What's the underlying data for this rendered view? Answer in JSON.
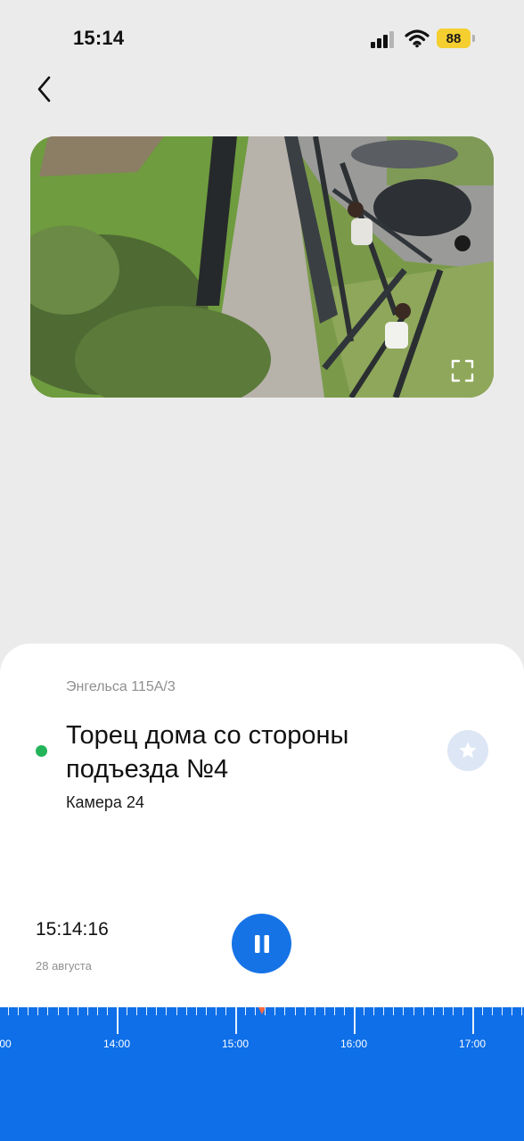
{
  "status_bar": {
    "time": "15:14",
    "battery": "88",
    "battery_color": "#f5cf30"
  },
  "nav": {
    "back_icon": "chevron-left-icon"
  },
  "video": {
    "fullscreen_icon": "fullscreen-icon"
  },
  "camera": {
    "address": "Энгельса 115А/3",
    "title": "Торец дома со стороны подъезда №4",
    "subtitle": "Камера 24",
    "online_color": "#23b45a",
    "favorite_icon": "star-icon"
  },
  "playback": {
    "current_time": "15:14:16",
    "current_date": "28 августа",
    "pause_icon": "pause-icon",
    "accent": "#1673e6"
  },
  "timeline": {
    "labels": [
      "00",
      "14:00",
      "15:00",
      "16:00",
      "17:00"
    ],
    "playhead_time": "15:14:16",
    "background": "#0e6fe8"
  }
}
